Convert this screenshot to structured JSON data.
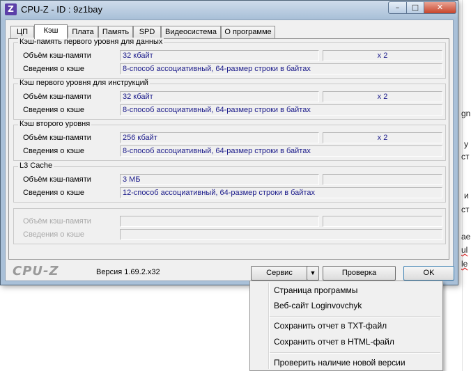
{
  "background": {
    "fragments": [
      "gn",
      "у",
      "ст",
      "и",
      "ст",
      "ае",
      "ul",
      "le"
    ]
  },
  "window": {
    "app_icon_letter": "Z",
    "title": "CPU-Z - ID : 9z1bay",
    "minimize_glyph": "–",
    "maximize_glyph": "□",
    "close_glyph": "✕"
  },
  "tabs": [
    {
      "label": "ЦП"
    },
    {
      "label": "Кэш"
    },
    {
      "label": "Плата"
    },
    {
      "label": "Память"
    },
    {
      "label": "SPD"
    },
    {
      "label": "Видеосистема"
    },
    {
      "label": "О программе"
    }
  ],
  "groups": [
    {
      "title": "Кэш-память первого уровня для данных",
      "size_label": "Объём кэш-памяти",
      "size_value": "32 кбайт",
      "multiplier": "x 2",
      "desc_label": "Сведения о кэше",
      "desc_value": "8-способ ассоциативный, 64-размер строки в байтах"
    },
    {
      "title": "Кэш первого уровня для инструкций",
      "size_label": "Объём кэш-памяти",
      "size_value": "32 кбайт",
      "multiplier": "x 2",
      "desc_label": "Сведения о кэше",
      "desc_value": "8-способ ассоциативный, 64-размер строки в байтах"
    },
    {
      "title": "Кэш второго уровня",
      "size_label": "Объём кэш-памяти",
      "size_value": "256 кбайт",
      "multiplier": "x 2",
      "desc_label": "Сведения о кэше",
      "desc_value": "8-способ ассоциативный, 64-размер строки в байтах"
    },
    {
      "title": "L3 Cache",
      "size_label": "Объём кэш-памяти",
      "size_value": "3 МБ",
      "multiplier": "",
      "desc_label": "Сведения о кэше",
      "desc_value": "12-способ ассоциативный, 64-размер строки в байтах"
    },
    {
      "title": "",
      "size_label": "Объём кэш-памяти",
      "size_value": "",
      "multiplier": "",
      "desc_label": "Сведения о кэше",
      "desc_value": ""
    }
  ],
  "footer": {
    "logo": "CPU-Z",
    "version": "Версия 1.69.2.x32",
    "service_button": "Сервис",
    "dropdown_glyph": "▼",
    "check_button": "Проверка",
    "ok_button": "OK"
  },
  "menu": {
    "items": [
      "Страница программы",
      "Веб-сайт Loginvovchyk",
      "Сохранить отчет в TXT-файл",
      "Сохранить отчет в HTML-файл",
      "Проверить наличие новой версии"
    ]
  }
}
